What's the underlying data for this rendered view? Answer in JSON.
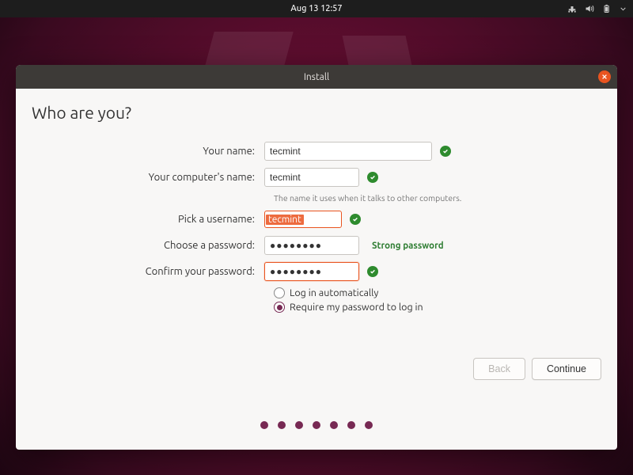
{
  "panel": {
    "clock": "Aug 13  12:57"
  },
  "titlebar": {
    "title": "Install"
  },
  "heading": "Who are you?",
  "labels": {
    "name": "Your name:",
    "hostname": "Your computer's name:",
    "hostname_hint": "The name it uses when it talks to other computers.",
    "username": "Pick a username:",
    "password": "Choose a password:",
    "confirm": "Confirm your password:"
  },
  "values": {
    "name": "tecmint",
    "hostname": "tecmint",
    "username": "tecmint",
    "password": "●●●●●●●●",
    "confirm": "●●●●●●●●",
    "password_strength": "Strong password"
  },
  "radios": {
    "auto": "Log in automatically",
    "require": "Require my password to log in"
  },
  "buttons": {
    "back": "Back",
    "continue": "Continue"
  }
}
